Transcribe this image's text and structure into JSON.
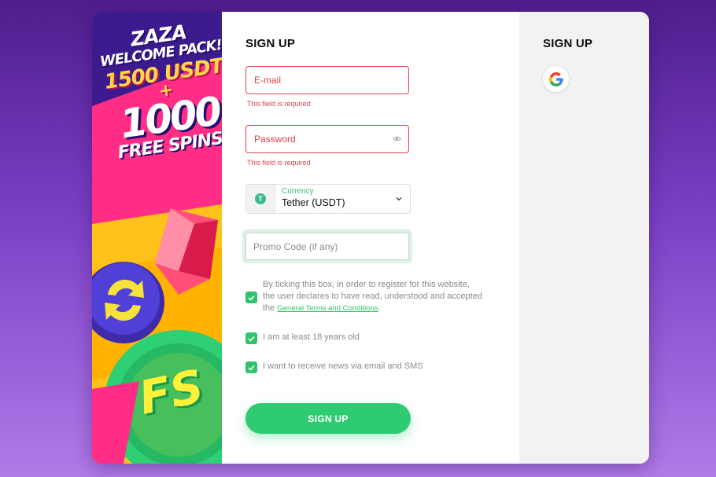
{
  "promo": {
    "line1": "ZAZA",
    "line2": "WELCOME PACK!",
    "line3": "1500 USDT",
    "line4": "+",
    "line5": "1000",
    "line6": "FREE SPINS!",
    "coin_text": "FS"
  },
  "form": {
    "title": "SIGN UP",
    "email": {
      "placeholder": "E-mail",
      "error": "This field is required"
    },
    "password": {
      "placeholder": "Password",
      "error": "This field is required"
    },
    "currency": {
      "label": "Currency",
      "value": "Tether (USDT)",
      "icon": "T"
    },
    "promo_code": {
      "placeholder": "Promo Code (if any)"
    },
    "terms": {
      "text": "By ticking this box, in order to register for this website, the user declares to have read, understood and accepted the",
      "link": "General Terms and Conditions",
      "suffix": ".",
      "checked": true
    },
    "age": {
      "text": "I am at least 18 years old",
      "checked": true
    },
    "news": {
      "text": "I want to receive news via email and SMS",
      "checked": true
    },
    "submit_label": "SIGN UP"
  },
  "social": {
    "title": "SIGN UP",
    "providers": [
      "google-icon"
    ]
  },
  "colors": {
    "accent": "#2ecb72",
    "error": "#e0414b",
    "background": "#6a2fb8"
  }
}
